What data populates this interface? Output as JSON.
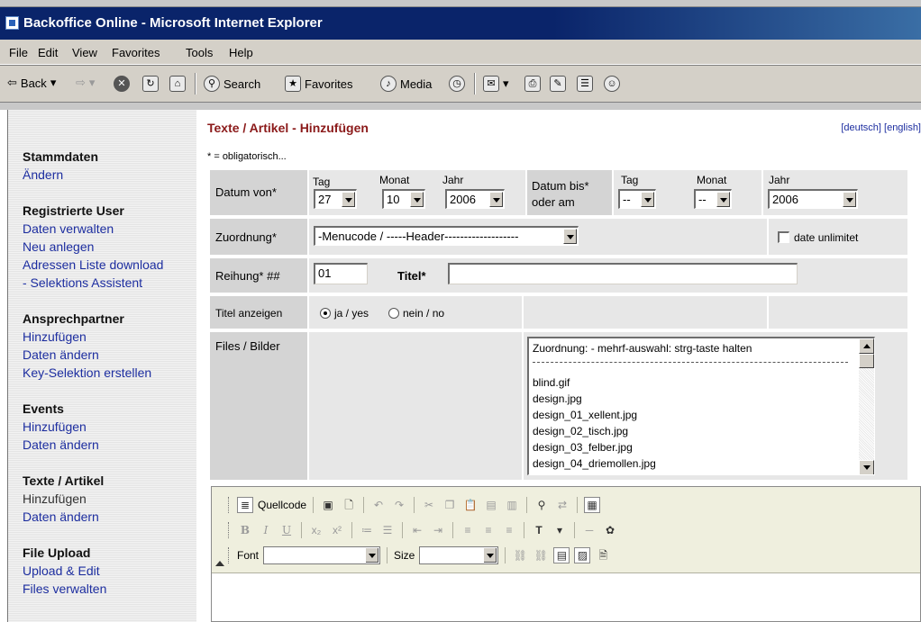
{
  "window": {
    "title": "Backoffice Online - Microsoft Internet Explorer"
  },
  "menu": [
    "File",
    "Edit",
    "View",
    "Favorites",
    "Tools",
    "Help"
  ],
  "toolbar": {
    "back": "Back",
    "search": "Search",
    "favorites": "Favorites",
    "media": "Media"
  },
  "sidebar": {
    "sections": [
      {
        "heading": "Stammdaten",
        "links": [
          "Ändern"
        ]
      },
      {
        "heading": "Registrierte User",
        "links": [
          "Daten verwalten",
          "Neu anlegen",
          "Adressen Liste download",
          "- Selektions Assistent"
        ]
      },
      {
        "heading": "Ansprechpartner",
        "links": [
          "Hinzufügen",
          "Daten ändern",
          "Key-Selektion erstellen"
        ]
      },
      {
        "heading": "Events",
        "links": [
          "Hinzufügen",
          "Daten ändern"
        ]
      },
      {
        "heading": "Texte / Artikel",
        "links": [
          "Hinzufügen",
          "Daten ändern"
        ]
      },
      {
        "heading": "File Upload",
        "links": [
          "Upload & Edit",
          "Files verwalten"
        ]
      }
    ]
  },
  "page": {
    "title": "Texte / Artikel - Hinzufügen",
    "lang_deutsch": "[deutsch]",
    "lang_english": "[english]",
    "obligatory_note": "* = obligatorisch..."
  },
  "form": {
    "datum_von_label": "Datum von*",
    "tag_label": "Tag",
    "monat_label": "Monat",
    "jahr_label": "Jahr",
    "tag_value": "27",
    "monat_value": "10",
    "jahr_value": "2006",
    "datum_bis_label_1": "Datum bis*",
    "datum_bis_label_2": "oder am",
    "bis_tag_value": "--",
    "bis_monat_value": "--",
    "bis_jahr_value": "2006",
    "zuordnung_label": "Zuordnung*",
    "zuordnung_value": "-Menucode / -----Header-------------------",
    "date_unlimited_label": "date unlimitet",
    "reihung_label": "Reihung* ##",
    "reihung_value": "01",
    "titel_label": "Titel*",
    "titel_value": "",
    "titel_anzeigen_label": "Titel anzeigen",
    "radio_yes": "ja / yes",
    "radio_no": "nein / no",
    "files_label": "Files / Bilder",
    "files_list": [
      "Zuordnung: - mehrf-auswahl: strg-taste halten",
      "blind.gif",
      "design.jpg",
      "design_01_xellent.jpg",
      "design_02_tisch.jpg",
      "design_03_felber.jpg",
      "design_04_driemollen.jpg"
    ]
  },
  "editor": {
    "source_label": "Quellcode",
    "font_label": "Font",
    "size_label": "Size"
  },
  "colors": {
    "titlebar": "#0a246a",
    "page_title": "#8b1a1a",
    "link": "#1d2ea0",
    "editor_toolbar": "#efefde"
  }
}
